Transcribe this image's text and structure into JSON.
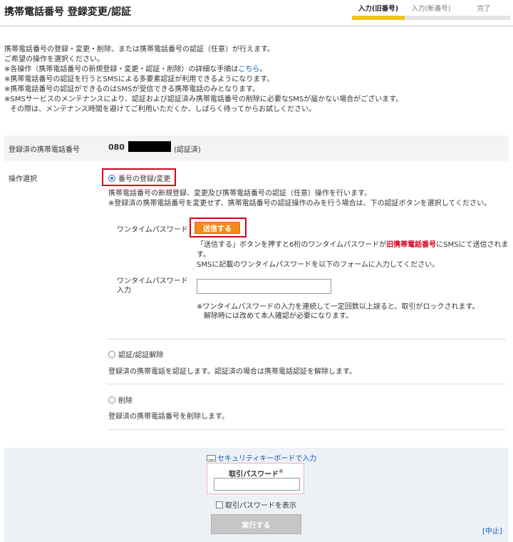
{
  "header": {
    "title": "携帯電話番号 登録変更/認証",
    "steps": [
      {
        "label": "入力(旧番号)",
        "state": "active"
      },
      {
        "label": "入力(新番号)",
        "state": "inactive"
      },
      {
        "label": "完了",
        "state": "inactive"
      }
    ]
  },
  "intro": {
    "line1": "携帯電話番号の登録・変更・削除、または携帯電話番号の認証（任意）が行えます。",
    "line2": "ご希望の操作を選択ください。",
    "line3_prefix": "※各操作（携帯電話番号の新規登録・変更・認証・削除）の詳細な手順は",
    "line3_link": "こちら",
    "line3_suffix": "。",
    "line4": "※携帯電話番号の認証を行うとSMSによる多要素認証が利用できるようになります。",
    "line5": "※携帯電話番号の認証ができるのはSMSが受信できる携帯電話のみとなります。",
    "line6": "※SMSサービスのメンテナンスにより、認証および認証済み携帯電話番号の削除に必要なSMSが届かない場合がございます。",
    "line7": "その際は、メンテナンス時間を避けてご利用いただくか、しばらく待ってからお試しください。"
  },
  "registered": {
    "label": "登録済の携帯電話番号",
    "number_prefix": "080",
    "status": "(認証済)"
  },
  "operation": {
    "label": "操作選択",
    "option1": {
      "label": "番号の登録/変更",
      "selected": true,
      "desc1": "携帯電話番号の新規登録、変更及び携帯電話番号の認証（任意）操作を行います。",
      "desc2": "※登録済の携帯電話番号を変更せず、携帯電話番号の認証操作のみを行う場合は、下の認証ボタンを選択してください。"
    },
    "otp": {
      "label": "ワンタイムパスワード",
      "send_button": "送信する",
      "note_part1": "「送信する」ボタンを押すと6桁のワンタイムパスワードが",
      "note_red": "旧携帯電話番号",
      "note_part2": "にSMSにて送信されます。",
      "note_line2": "SMSに記載のワンタイムパスワードを以下のフォームに入力してください。",
      "input_label_line1": "ワンタイムパスワード",
      "input_label_line2": "入力",
      "input_value": "",
      "lock_note1": "※ワンタイムパスワードの入力を連続して一定回数以上誤ると、取引がロックされます。",
      "lock_note2": "解除時には改めて本人確認が必要になります。"
    },
    "option2": {
      "label": "認証/認証解除",
      "selected": false,
      "desc": "登録済の携帯電話を認証します。認証済の場合は携帯電話認証を解除します。"
    },
    "option3": {
      "label": "削除",
      "selected": false,
      "desc": "登録済の携帯電話番号を削除します。"
    }
  },
  "footer": {
    "keyboard_link": "セキュリティキーボードで入力",
    "password_label": "取引パスワード",
    "password_mark": "※",
    "password_value": "",
    "show_password": "取引パスワードを表示",
    "execute_button": "実行する",
    "cancel_link": "[中止]"
  },
  "colors": {
    "step_active": "#f2c21b",
    "highlight_border": "#d6001c",
    "send_button": "#f28b1e",
    "link": "#0a58c5",
    "footer_bg": "#edf1f6"
  }
}
